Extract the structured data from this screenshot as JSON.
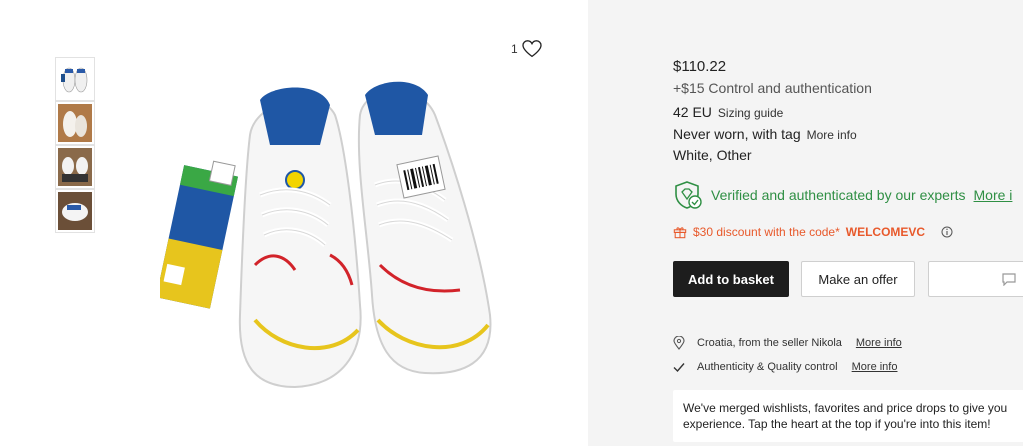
{
  "product": {
    "like_count": "1",
    "price": "$110.22",
    "fee": "+$15 Control and authentication",
    "size": "42 EU",
    "sizing_guide": "Sizing guide",
    "condition": "Never worn, with tag",
    "condition_more": "More info",
    "colors": "White, Other"
  },
  "verification": {
    "text": "Verified and authenticated by our experts",
    "more": "More i"
  },
  "discount": {
    "text": "$30 discount with the code*",
    "code": "WELCOMEVC"
  },
  "actions": {
    "add_to_basket": "Add to basket",
    "make_offer": "Make an offer"
  },
  "details": {
    "location": "Croatia, from the seller Nikola",
    "location_more": "More info",
    "authenticity": "Authenticity & Quality control",
    "authenticity_more": "More info"
  },
  "notice": {
    "line1": "We've merged wishlists, favorites and price drops to give you",
    "line2": "experience. Tap the heart at the top if you're into this item!"
  },
  "colors": {
    "verified_green": "#2f8f44",
    "discount_orange": "#e8592b",
    "button_dark": "#1d1d1d"
  }
}
